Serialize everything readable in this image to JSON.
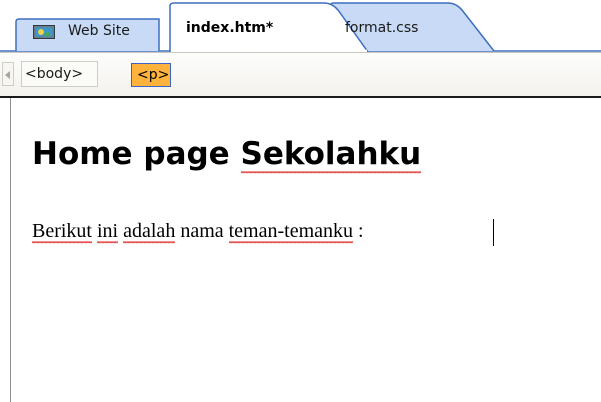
{
  "tabs": [
    {
      "label": "Web Site",
      "icon": "website-icon",
      "active": false
    },
    {
      "label": "index.htm*",
      "active": true
    },
    {
      "label": "format.css",
      "active": false
    }
  ],
  "tag_selector": {
    "tags": [
      "<body>",
      "<p>"
    ],
    "selected": "<p>"
  },
  "document": {
    "heading_words": [
      "Home",
      "page",
      "Sekolahku"
    ],
    "paragraph_words": [
      "Berikut",
      "ini",
      "adalah",
      "nama",
      "teman-temanku",
      ":"
    ]
  },
  "colors": {
    "tab_fill": "#c8daf5",
    "tab_border": "#3e6fbf",
    "tag_selected": "#ffb23c",
    "spell_underline": "#e03030"
  }
}
